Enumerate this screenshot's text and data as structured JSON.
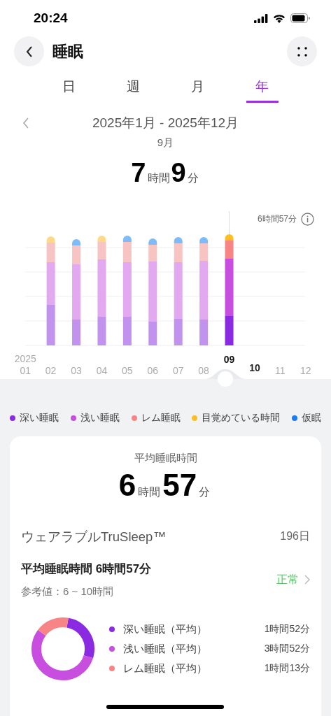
{
  "status_bar": {
    "time": "20:24"
  },
  "header": {
    "title": "睡眠"
  },
  "tabs": [
    {
      "label": "日",
      "selected": false
    },
    {
      "label": "週",
      "selected": false
    },
    {
      "label": "月",
      "selected": false
    },
    {
      "label": "年",
      "selected": true
    }
  ],
  "range": {
    "label": "2025年1月 - 2025年12月",
    "selected_period": "9月"
  },
  "total": {
    "hours": "7",
    "hours_unit": "時間",
    "minutes": "9",
    "minutes_unit": "分"
  },
  "chart": {
    "average_label": "6時間57分",
    "year_label": "2025",
    "months": [
      {
        "label": "01",
        "selected": false,
        "highlighted": false
      },
      {
        "label": "02",
        "selected": false,
        "highlighted": false
      },
      {
        "label": "03",
        "selected": false,
        "highlighted": false
      },
      {
        "label": "04",
        "selected": false,
        "highlighted": false
      },
      {
        "label": "05",
        "selected": false,
        "highlighted": false
      },
      {
        "label": "06",
        "selected": false,
        "highlighted": false
      },
      {
        "label": "07",
        "selected": false,
        "highlighted": false
      },
      {
        "label": "08",
        "selected": false,
        "highlighted": false
      },
      {
        "label": "09",
        "selected": true,
        "highlighted": false
      },
      {
        "label": "10",
        "selected": false,
        "highlighted": true
      },
      {
        "label": "11",
        "selected": false,
        "highlighted": false
      },
      {
        "label": "12",
        "selected": false,
        "highlighted": false
      }
    ]
  },
  "legend": [
    {
      "label": "深い睡眠",
      "color": "#8a2be2"
    },
    {
      "label": "浅い睡眠",
      "color": "#c84ee0"
    },
    {
      "label": "レム睡眠",
      "color": "#f88585"
    },
    {
      "label": "目覚めている時間",
      "color": "#fbbf24"
    },
    {
      "label": "仮眠",
      "color": "#1a7cf5"
    }
  ],
  "summary": {
    "title": "平均睡眠時間",
    "hours": "6",
    "hours_unit": "時間",
    "minutes": "57",
    "minutes_unit": "分",
    "source": "ウェアラブルTruSleep™",
    "days": "196日",
    "detail_title": "平均睡眠時間 6時間57分",
    "reference": "参考値：6 ~ 10時間",
    "status": "正常",
    "breakdown": [
      {
        "label": "深い睡眠（平均）",
        "value": "1時間52分",
        "color": "#8a2be2"
      },
      {
        "label": "浅い睡眠（平均）",
        "value": "3時間52分",
        "color": "#c84ee0"
      },
      {
        "label": "レム睡眠（平均）",
        "value": "1時間13分",
        "color": "#f88585"
      }
    ]
  }
}
